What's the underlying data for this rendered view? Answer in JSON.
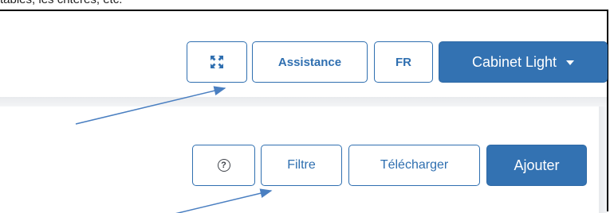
{
  "caption": "tables, les critères, etc.",
  "header": {
    "fullscreen_icon": "expand-arrows-icon",
    "assistance_label": "Assistance",
    "language_label": "FR",
    "account_label": "Cabinet Light",
    "account_icon": "caret-down-icon"
  },
  "toolbar": {
    "help_icon": "question-circle-icon",
    "help_glyph": "?",
    "filter_label": "Filtre",
    "download_label": "Télécharger",
    "add_label": "Ajouter"
  },
  "colors": {
    "accent": "#3372b2",
    "annotation_arrow": "#4a7fc1",
    "border": "#2f6fb0"
  }
}
